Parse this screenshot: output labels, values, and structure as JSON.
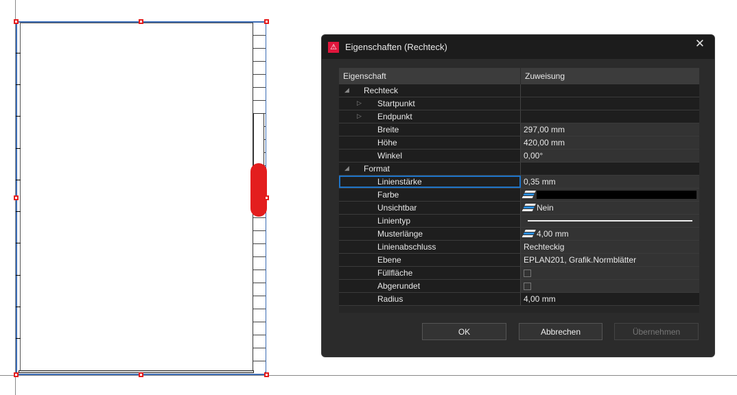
{
  "dialog": {
    "title": "Eigenschaften (Rechteck)",
    "close_icon": "close-icon",
    "header": {
      "property": "Eigenschaft",
      "value": "Zuweisung"
    },
    "rows": [
      {
        "name": "Rechteck",
        "value": ""
      },
      {
        "name": "Startpunkt",
        "value": ""
      },
      {
        "name": "Endpunkt",
        "value": ""
      },
      {
        "name": "Breite",
        "value": "297,00 mm"
      },
      {
        "name": "Höhe",
        "value": "420,00 mm"
      },
      {
        "name": "Winkel",
        "value": "0,00°"
      },
      {
        "name": "Format",
        "value": ""
      },
      {
        "name": "Linienstärke",
        "value": "0,35 mm"
      },
      {
        "name": "Farbe",
        "value": "#000000"
      },
      {
        "name": "Unsichtbar",
        "value": "Nein"
      },
      {
        "name": "Linientyp",
        "value": ""
      },
      {
        "name": "Musterlänge",
        "value": "4,00 mm"
      },
      {
        "name": "Linienabschluss",
        "value": "Rechteckig"
      },
      {
        "name": "Ebene",
        "value": "EPLAN201, Grafik.Normblätter"
      },
      {
        "name": "Füllfläche",
        "value": false
      },
      {
        "name": "Abgerundet",
        "value": false
      },
      {
        "name": "Radius",
        "value": "4,00 mm"
      }
    ],
    "buttons": {
      "ok": "OK",
      "cancel": "Abbrechen",
      "apply": "Übernehmen"
    }
  },
  "colors": {
    "selection": "#3b6cb5",
    "handle": "#e51c1c",
    "accent": "#1e74c8"
  }
}
